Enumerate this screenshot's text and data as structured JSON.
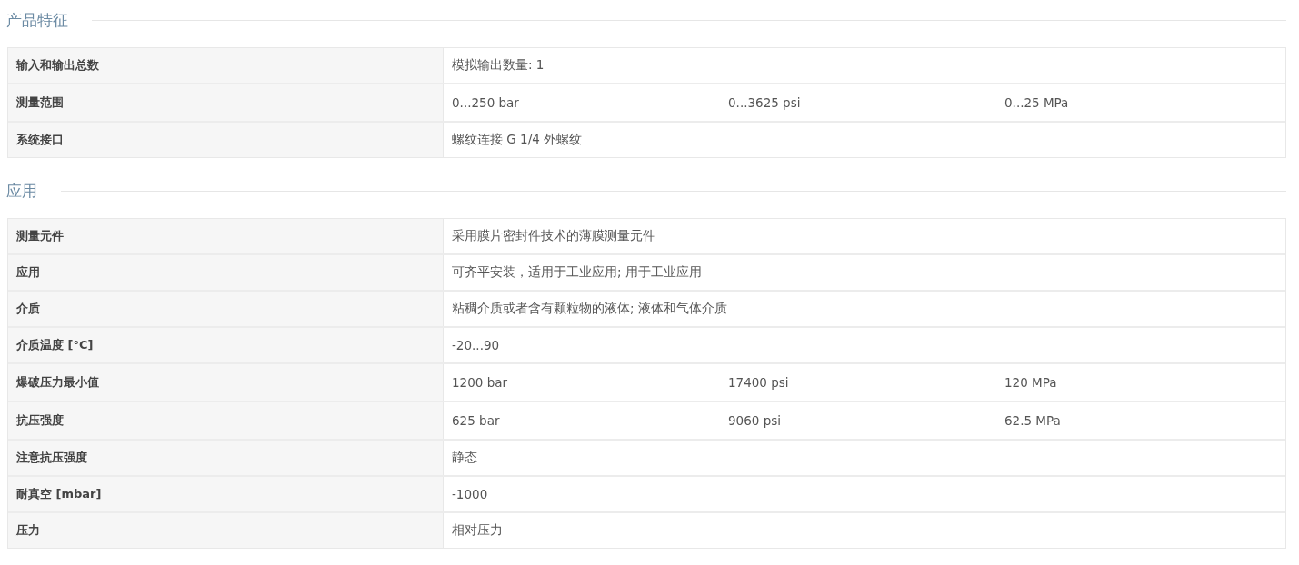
{
  "sections": [
    {
      "title": "产品特征",
      "rows": [
        {
          "label": "输入和输出总数",
          "values": [
            "模拟输出数量: 1"
          ]
        },
        {
          "label": "测量范围",
          "values": [
            "0...250 bar",
            "0...3625 psi",
            "0...25 MPa"
          ]
        },
        {
          "label": "系统接口",
          "values": [
            "螺纹连接 G 1/4 外螺纹"
          ]
        }
      ]
    },
    {
      "title": "应用",
      "rows": [
        {
          "label": "测量元件",
          "values": [
            "采用膜片密封件技术的薄膜测量元件"
          ]
        },
        {
          "label": "应用",
          "values": [
            "可齐平安装，适用于工业应用; 用于工业应用"
          ]
        },
        {
          "label": "介质",
          "values": [
            "粘稠介质或者含有颗粒物的液体; 液体和气体介质"
          ]
        },
        {
          "label": "介质温度 [°C]",
          "values": [
            "-20...90"
          ]
        },
        {
          "label": "爆破压力最小值",
          "values": [
            "1200 bar",
            "17400 psi",
            "120 MPa"
          ]
        },
        {
          "label": "抗压强度",
          "values": [
            "625 bar",
            "9060 psi",
            "62.5 MPa"
          ]
        },
        {
          "label": "注意抗压强度",
          "values": [
            "静态"
          ]
        },
        {
          "label": "耐真空 [mbar]",
          "values": [
            "-1000"
          ]
        },
        {
          "label": "压力",
          "values": [
            "相对压力"
          ]
        }
      ]
    }
  ]
}
